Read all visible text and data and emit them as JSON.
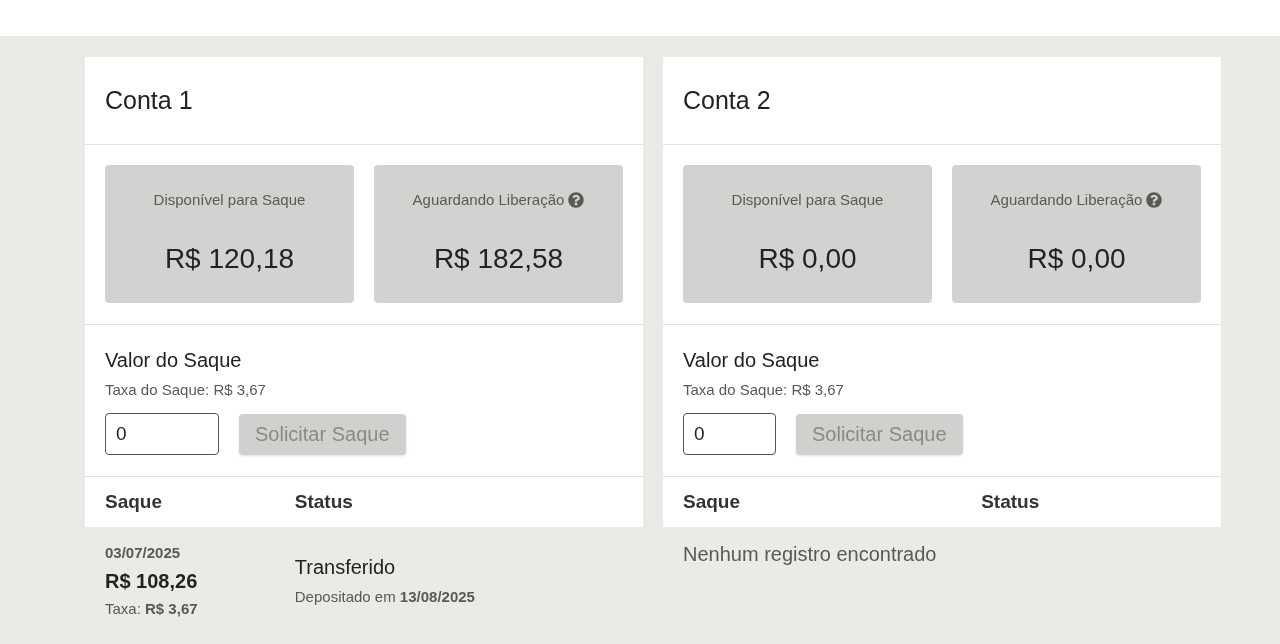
{
  "accounts": [
    {
      "title": "Conta 1",
      "balances": [
        {
          "label": "Disponível para Saque",
          "amount": "R$ 120,18",
          "help": false
        },
        {
          "label": "Aguardando Liberação",
          "amount": "R$ 182,58",
          "help": true
        }
      ],
      "withdraw": {
        "label": "Valor do Saque",
        "fee": "Taxa do Saque: R$ 3,67",
        "input_value": "0",
        "button": {
          "label": "Solicitar Saque",
          "disabled": true
        }
      },
      "table": {
        "columns": [
          "Saque",
          "Status"
        ],
        "rows": [
          {
            "date": "03/07/2025",
            "amount": "R$ 108,26",
            "fee": "Taxa: **R$ 3,67**",
            "status": "Transferido",
            "detail": "Depositado em **13/08/2025**"
          }
        ]
      }
    },
    {
      "title": "Conta 2",
      "balances": [
        {
          "label": "Disponível para Saque",
          "amount": "R$ 0,00",
          "help": false
        },
        {
          "label": "Aguardando Liberação",
          "amount": "R$ 0,00",
          "help": true
        }
      ],
      "withdraw": {
        "label": "Valor do Saque",
        "fee": "Taxa do Saque: R$ 3,67",
        "input_value": "0",
        "button": {
          "label": "Solicitar Saque",
          "disabled": true
        }
      },
      "table": {
        "columns": [
          "Saque",
          "Status"
        ],
        "empty_message": "Nenhum registro encontrado"
      }
    }
  ]
}
